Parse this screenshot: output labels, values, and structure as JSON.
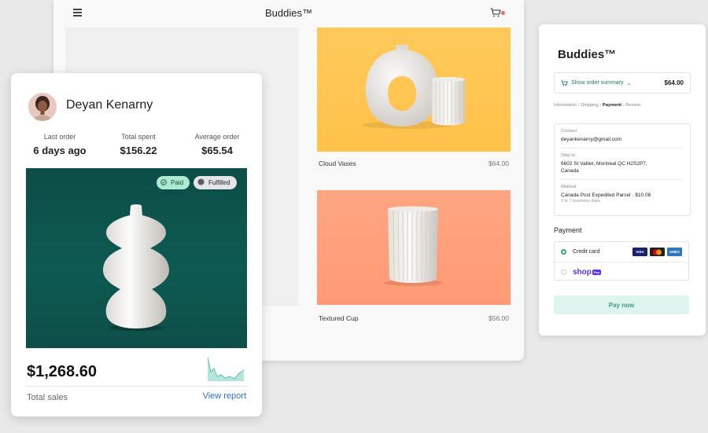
{
  "store": {
    "title": "Buddies™",
    "products": [
      {
        "name": "Cloud Vases",
        "price": "$64.00"
      },
      {
        "name": "Textured Cup",
        "price": "$56.00"
      }
    ]
  },
  "checkout": {
    "title": "Buddies™",
    "summary_label": "Show order summary",
    "summary_amount": "$64.00",
    "breadcrumbs": [
      "Information",
      "Shipping",
      "Payment",
      "Review"
    ],
    "breadcrumb_current": "Payment",
    "contact_label": "Contact",
    "contact_value": "deyankenarny@gmail.com",
    "ship_label": "Ship to",
    "ship_line1": "6602 St Vallier, Montreal QC  H2S2P7,",
    "ship_line2": "Canada",
    "method_label": "Method",
    "method_value": "Canada Post Expedited Parcel · $10.08",
    "method_sub": "1 to 7 business days",
    "payment_heading": "Payment",
    "credit_card_label": "Credit card",
    "card_brands": [
      "VISA",
      "MC",
      "AMEX"
    ],
    "shop_pay_label": "shop",
    "shop_pay_tag": "Pay",
    "pay_button": "Pay now"
  },
  "customer": {
    "name": "Deyan Kenarny",
    "stats": [
      {
        "label": "Last order",
        "value": "6 days ago"
      },
      {
        "label": "Total spent",
        "value": "$156.22"
      },
      {
        "label": "Average order",
        "value": "$65.54"
      }
    ],
    "badges": {
      "paid": "Paid",
      "fulfilled": "Fulfilled"
    },
    "total_sales_value": "$1,268.60",
    "total_sales_label": "Total sales",
    "view_report": "View report"
  },
  "colors": {
    "accent_green": "#1f7a57",
    "hero_teal": "#0d5a52",
    "link_blue": "#2c6ecb",
    "yellow_bg": "#ffc95a",
    "coral_bg": "#ff9f7c"
  }
}
